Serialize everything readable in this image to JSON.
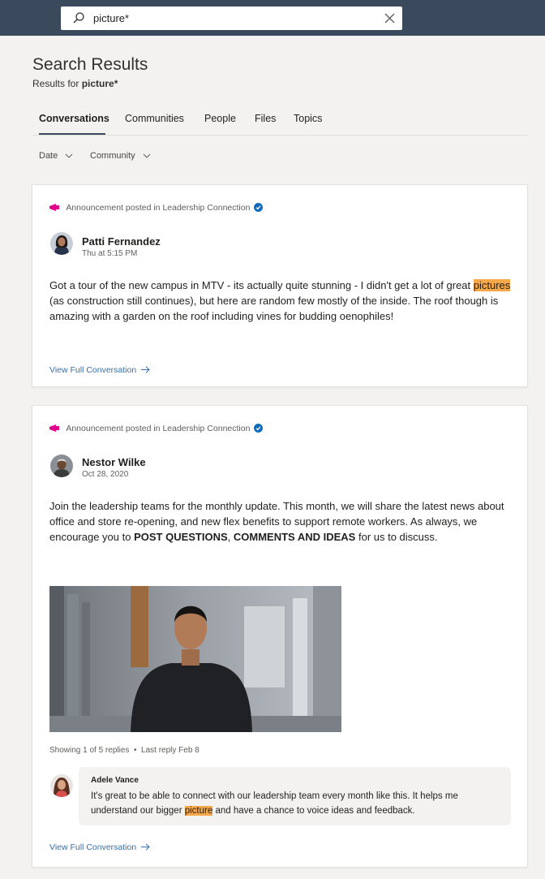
{
  "search": {
    "value": "picture*",
    "placeholder": ""
  },
  "page": {
    "title": "Search Results",
    "results_for_label": "Results for",
    "query": "picture*"
  },
  "tabs": [
    {
      "label": "Conversations",
      "active": true
    },
    {
      "label": "Communities",
      "active": false
    },
    {
      "label": "People",
      "active": false
    },
    {
      "label": "Files",
      "active": false
    },
    {
      "label": "Topics",
      "active": false
    }
  ],
  "filters": {
    "date": "Date",
    "community": "Community"
  },
  "icons": {
    "search": "search-icon",
    "clear": "close-icon",
    "chevron": "chevron-down-icon",
    "announcement": "megaphone-icon",
    "verified": "verified-badge-icon",
    "arrow": "arrow-right-icon"
  },
  "colors": {
    "topbar": "#3a4a5c",
    "highlight": "#f7a94a",
    "link": "#3a6fa8",
    "announcement": "#e3008c",
    "verified": "#0f6cbd"
  },
  "posts": [
    {
      "meta_prefix": "Announcement posted in",
      "community": "Leadership Connection",
      "author": "Patti Fernandez",
      "time": "Thu at 5:15 PM",
      "body_before": "Got a tour of the new campus in MTV - its actually quite stunning - I didn't get a lot of great ",
      "body_highlight": "pictures",
      "body_after": " (as construction still continues), but here are random few mostly of the inside. The roof though is amazing with a garden on the roof including vines for budding oenophiles!",
      "link": "View Full Conversation"
    },
    {
      "meta_prefix": "Announcement posted in",
      "community": "Leadership Connection",
      "author": "Nestor Wilke",
      "time": "Oct 28, 2020",
      "body_before": "Join the leadership teams for the monthly update. This month, we will share the latest news about office and store re-opening, and new flex benefits to support remote workers. As always, we encourage you to ",
      "body_bold_1": "POST QUESTIONS",
      "body_comma": ", ",
      "body_bold_2": "COMMENTS AND IDEAS",
      "body_after": " for us to discuss.",
      "replies_info": "Showing 1 of 5 replies",
      "separator": "•",
      "last_reply": "Last reply Feb 8",
      "reply": {
        "author": "Adele Vance",
        "text_before": "It's great to be able to connect with our leadership team every month like this. It helps me understand our bigger ",
        "highlight": "picture",
        "text_after": " and have a chance to voice ideas and feedback."
      },
      "link": "View Full Conversation"
    }
  ]
}
